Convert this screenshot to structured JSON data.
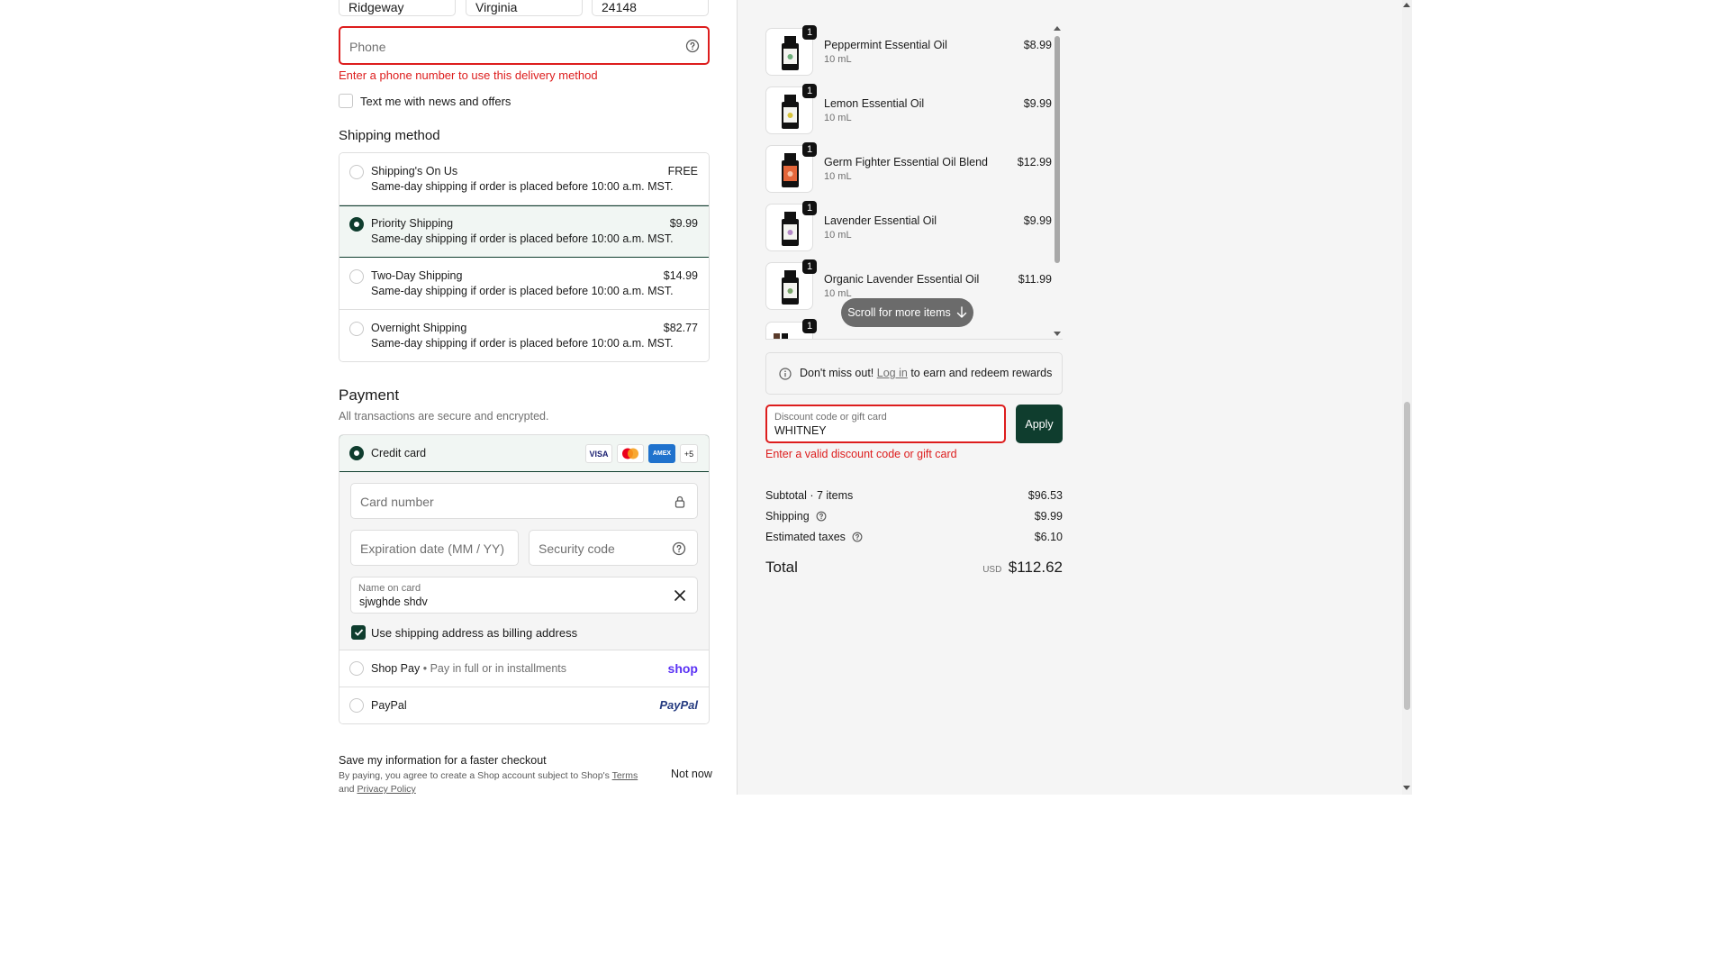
{
  "address": {
    "city": "Ridgeway",
    "state": "Virginia",
    "zip": "24148"
  },
  "phone": {
    "placeholder": "Phone",
    "error": "Enter a phone number to use this delivery method"
  },
  "marketing": {
    "sms_label": "Text me with news and offers"
  },
  "shipping": {
    "title": "Shipping method",
    "options": [
      {
        "name": "Shipping's On Us",
        "desc": "Same-day shipping if order is placed before 10:00 a.m. MST.",
        "price": "FREE"
      },
      {
        "name": "Priority Shipping",
        "desc": "Same-day shipping if order is placed before 10:00 a.m. MST.",
        "price": "$9.99"
      },
      {
        "name": "Two-Day Shipping",
        "desc": "Same-day shipping if order is placed before 10:00 a.m. MST.",
        "price": "$14.99"
      },
      {
        "name": "Overnight Shipping",
        "desc": "Same-day shipping if order is placed before 10:00 a.m. MST.",
        "price": "$82.77"
      }
    ],
    "selected_index": 1
  },
  "payment": {
    "title": "Payment",
    "subtitle": "All transactions are secure and encrypted.",
    "credit_card_label": "Credit card",
    "card_badges": [
      "VISA",
      "MC",
      "AMEX",
      "+5"
    ],
    "card_number_placeholder": "Card number",
    "expiration_placeholder": "Expiration date (MM / YY)",
    "security_placeholder": "Security code",
    "name_label": "Name on card",
    "name_value": "sjwghde shdv",
    "billing_label": "Use shipping address as billing address",
    "shop_pay_label": "Shop Pay",
    "shop_pay_sub": "Pay in full or in installments",
    "shop_pay_logo": "shop",
    "paypal_label": "PayPal",
    "paypal_logo": "PayPal"
  },
  "save_info": {
    "title": "Save my information for a faster checkout",
    "legal_prefix": "By paying, you agree to create a Shop account subject to Shop's",
    "terms": "Terms",
    "and": "and",
    "privacy": "Privacy Policy",
    "not_now": "Not now"
  },
  "cart": {
    "items": [
      {
        "name": "Peppermint Essential Oil",
        "size": "10 mL",
        "price": "$8.99",
        "qty": "1",
        "accent": "#6fae7b"
      },
      {
        "name": "Lemon Essential Oil",
        "size": "10 mL",
        "price": "$9.99",
        "qty": "1",
        "accent": "#d8c43a"
      },
      {
        "name": "Germ Fighter Essential Oil Blend",
        "size": "10 mL",
        "price": "$12.99",
        "qty": "1",
        "accent": "#e4663a"
      },
      {
        "name": "Lavender Essential Oil",
        "size": "10 mL",
        "price": "$9.99",
        "qty": "1",
        "accent": "#b58ac8"
      },
      {
        "name": "Organic Lavender Essential Oil",
        "size": "10 mL",
        "price": "$11.99",
        "qty": "1",
        "accent": "#7aa56a"
      },
      {
        "name": "",
        "size": "",
        "price": "",
        "qty": "1",
        "accent": "#5a3a2a"
      }
    ],
    "scroll_pill": "Scroll for more items"
  },
  "rewards": {
    "prefix": "Don't miss out!",
    "link": "Log in",
    "suffix": "to earn and redeem rewards"
  },
  "discount": {
    "label": "Discount code or gift card",
    "value": "WHITNEY",
    "apply": "Apply",
    "error": "Enter a valid discount code or gift card"
  },
  "summary": {
    "subtotal_label": "Subtotal · 7 items",
    "subtotal": "$96.53",
    "shipping_label": "Shipping",
    "shipping": "$9.99",
    "taxes_label": "Estimated taxes",
    "taxes": "$6.10",
    "total_label": "Total",
    "currency": "USD",
    "total": "$112.62"
  },
  "colors": {
    "accent": "#0f3d2e",
    "error": "#dd1d1d",
    "shop_pay": "#5a31f4",
    "paypal_dark": "#253b80",
    "paypal_light": "#179bd7"
  }
}
